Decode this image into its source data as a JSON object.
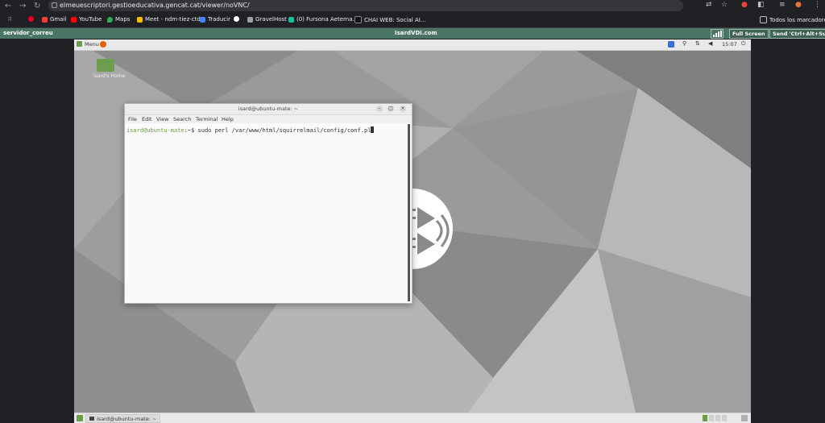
{
  "browser": {
    "url": "elmeuescriptori.gestioeducativa.gencat.cat/viewer/noVNC/",
    "bookmarks": [
      "Gmail",
      "YouTube",
      "Maps",
      "Meet - ndm-tiez-ctd",
      "Traducir",
      "GravelHost",
      "(0) Fursona Aeterna...",
      "CHAI WEB: Social AI..."
    ],
    "all_bookmarks": "Todos los marcadores"
  },
  "vnc": {
    "left_label": "servidor_correu",
    "title": "IsardVDI.com",
    "full_screen": "Full Screen",
    "send_keys": "Send 'Ctrl+Alt+Supr'"
  },
  "desktop": {
    "menu_label": "Menu",
    "clock": "15:07",
    "home_icon_label": "isard's Home"
  },
  "terminal": {
    "title": "isard@ubuntu-mate: ~",
    "menu": [
      "File",
      "Edit",
      "View",
      "Search",
      "Terminal",
      "Help"
    ],
    "prompt_user": "isard@ubuntu-mate",
    "prompt_sep": ":~$",
    "command": "sudo perl /var/www/html/squirrelmail/config/conf.pl"
  },
  "taskbar": {
    "window_label": "isard@ubuntu-mate: ~"
  }
}
